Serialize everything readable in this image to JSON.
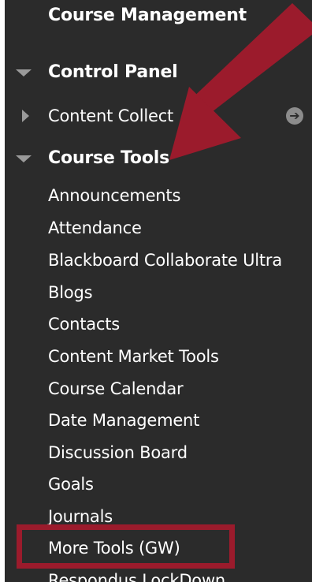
{
  "panel": {
    "section_title": "Course Management",
    "control_panel_label": "Control Panel",
    "content_collection_label": "Content Collect",
    "course_tools_label": "Course Tools",
    "items": [
      "Announcements",
      "Attendance",
      "Blackboard Collaborate Ultra",
      "Blogs",
      "Contacts",
      "Content Market Tools",
      "Course Calendar",
      "Date Management",
      "Discussion Board",
      "Goals",
      "Journals",
      "More Tools (GW)",
      "Respondus LockDown"
    ],
    "highlighted_item": "More Tools (GW)"
  },
  "colors": {
    "panel_bg": "#2b2b2b",
    "text": "#ffffff",
    "triangle": "#9a9a9a",
    "annotation_red": "#9b1b2c"
  },
  "icons": {
    "expanded": "triangle-down-icon",
    "collapsed": "triangle-right-icon",
    "go": "circle-arrow-right-icon"
  }
}
